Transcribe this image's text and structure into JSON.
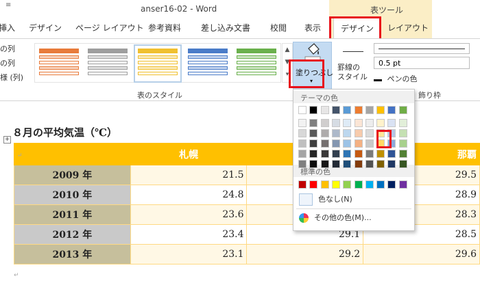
{
  "window": {
    "title": "anser16-02 - Word",
    "context_tab_group": "表ツール",
    "quick_access_mark": "≡"
  },
  "tabs": [
    {
      "label": "挿入"
    },
    {
      "label": "デザイン"
    },
    {
      "label": "ページ レイアウト"
    },
    {
      "label": "参考資料"
    },
    {
      "label": "差し込み文書"
    },
    {
      "label": "校閲"
    },
    {
      "label": "表示"
    },
    {
      "label": "デザイン"
    },
    {
      "label": "レイアウト"
    }
  ],
  "ribbon": {
    "left_options": [
      "の列",
      "の列",
      "様 (列)"
    ],
    "table_styles_group": "表のスタイル",
    "table_style_colors": [
      "#e87b3b",
      "#9e9e9e",
      "#f0c030",
      "#4a7cc8",
      "#6ab04c"
    ],
    "selected_style_index": 2,
    "fill_label": "塗りつぶし",
    "fill_caret": "▾",
    "border_style_label": "罫線の\nスタイル",
    "pen_width": "0.5 pt",
    "pen_color_label": "ペンの色",
    "borders_group": "飾り枠",
    "scroll_arrows": [
      "▲",
      "▼",
      "▾"
    ]
  },
  "document": {
    "caption": "８月の平均気温（℃）",
    "anchor_symbol": "+",
    "mark": "↵",
    "para_mark": "↵",
    "table": {
      "headers": [
        "",
        "札幌",
        "",
        "那覇"
      ],
      "rows": [
        {
          "label": "2009 年",
          "values": [
            "21.5",
            "",
            "29.5"
          ]
        },
        {
          "label": "2010 年",
          "values": [
            "24.8",
            "",
            "28.9"
          ]
        },
        {
          "label": "2011 年",
          "values": [
            "23.6",
            "",
            "28.3"
          ]
        },
        {
          "label": "2012 年",
          "values": [
            "23.4",
            "29.1",
            "28.5"
          ]
        },
        {
          "label": "2013 年",
          "values": [
            "23.1",
            "29.2",
            "29.6"
          ]
        }
      ]
    }
  },
  "color_panel": {
    "theme_colors_label": "テーマの色",
    "theme_top": [
      "#ffffff",
      "#000000",
      "#e7e6e6",
      "#44546a",
      "#5b9bd5",
      "#ed7d31",
      "#a5a5a5",
      "#ffc000",
      "#4472c4",
      "#70ad47"
    ],
    "theme_shades": [
      [
        "#f2f2f2",
        "#7f7f7f",
        "#d0cece",
        "#d6dce4",
        "#deebf6",
        "#fbe5d5",
        "#ededed",
        "#fff2cc",
        "#d9e2f3",
        "#e2efd9"
      ],
      [
        "#d8d8d8",
        "#595959",
        "#aeabab",
        "#adb9ca",
        "#bdd7ee",
        "#f7cbac",
        "#dbdbdb",
        "#fee599",
        "#b4c6e7",
        "#c5e0b3"
      ],
      [
        "#bfbfbf",
        "#3f3f3f",
        "#757070",
        "#8496b0",
        "#9dc3e6",
        "#f4b183",
        "#c9c9c9",
        "#ffd965",
        "#8eaadb",
        "#a8d08d"
      ],
      [
        "#a5a5a5",
        "#262626",
        "#3a3838",
        "#323f4f",
        "#2e75b5",
        "#c55a11",
        "#7b7b7b",
        "#bf9000",
        "#2f5496",
        "#538135"
      ],
      [
        "#7f7f7f",
        "#0c0c0c",
        "#171616",
        "#222a35",
        "#1e4e79",
        "#833c0b",
        "#525252",
        "#7f6000",
        "#1f3864",
        "#375623"
      ]
    ],
    "standard_colors_label": "標準の色",
    "standard_colors": [
      "#c00000",
      "#ff0000",
      "#ffc000",
      "#ffff00",
      "#92d050",
      "#00b050",
      "#00b0f0",
      "#0070c0",
      "#002060",
      "#7030a0"
    ],
    "no_color_label": "色なし(N)",
    "more_colors_label": "その他の色(M)...",
    "highlight_color": "#e8101a"
  }
}
